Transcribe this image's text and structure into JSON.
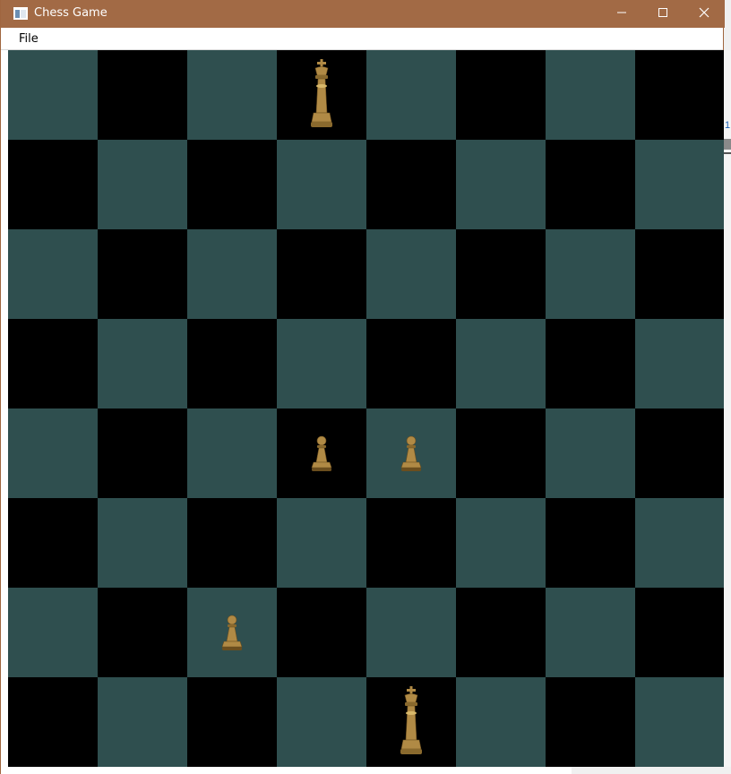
{
  "window": {
    "title": "Chess Game",
    "icon": "app-window-icon"
  },
  "controls": {
    "minimize_icon": "minimize-icon",
    "maximize_icon": "maximize-icon",
    "close_icon": "close-icon"
  },
  "menu": {
    "items": [
      {
        "label": "File"
      }
    ]
  },
  "board": {
    "light_color": "#2f4f4f",
    "dark_color": "#000000",
    "piece_color": "#b08a45",
    "pieces": [
      {
        "type": "king",
        "row": 0,
        "col": 3
      },
      {
        "type": "pawn",
        "row": 4,
        "col": 3
      },
      {
        "type": "pawn",
        "row": 4,
        "col": 4
      },
      {
        "type": "pawn",
        "row": 6,
        "col": 2
      },
      {
        "type": "king",
        "row": 7,
        "col": 4
      }
    ]
  },
  "side_strip": {
    "link_text": "1"
  }
}
